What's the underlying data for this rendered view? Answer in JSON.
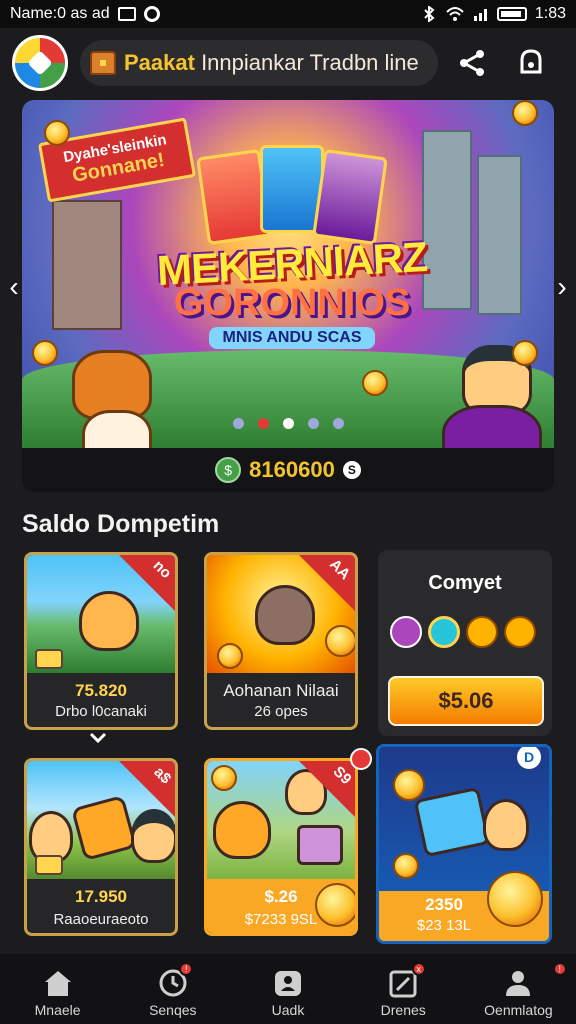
{
  "status_bar": {
    "left_text": "Name:0 as ad",
    "time": "1:83"
  },
  "header": {
    "title_accent": "Paakat",
    "title_rest": " Innpiankar Tradbn line"
  },
  "banner": {
    "ribbon_line1": "Dyahe'sleinkin",
    "ribbon_line2": "Gonnane!",
    "headline_line1": "MEKERNIARZ",
    "headline_line2": "GORONNIOS",
    "headline_line3": "MNIS ANDU SCAS",
    "balance": "8160600",
    "balance_coin_letter": "S",
    "dots": 5,
    "active_dot": 2
  },
  "section": {
    "title": "Saldo Dompetim"
  },
  "cards": [
    {
      "price": "75.820",
      "name": "Drbo l0canaki",
      "corner": "no"
    },
    {
      "price": "Aohanan Nilaai",
      "name": "26 opes",
      "corner": "AA"
    },
    {
      "price": "17.950",
      "name": "Raaoeuraeoto",
      "corner": "a$"
    },
    {
      "price": "$.26",
      "name": "$7233 9SL",
      "corner": "S9"
    },
    {
      "price": "2350",
      "name": "$23 13L",
      "corner": ""
    }
  ],
  "promo": {
    "title": "Comyet",
    "button_label": "$5.06"
  },
  "bottom_nav": [
    {
      "label": "Mnaele",
      "icon": "home-icon",
      "badge": false
    },
    {
      "label": "Senqes",
      "icon": "clock-icon",
      "badge": true
    },
    {
      "label": "Uadk",
      "icon": "profile-card-icon",
      "badge": false
    },
    {
      "label": "Drenes",
      "icon": "edit-icon",
      "badge": true
    },
    {
      "label": "Oenmlatog",
      "icon": "user-icon",
      "badge": true
    }
  ],
  "colors": {
    "accent_gold": "#f4c430",
    "badge_red": "#e53935",
    "card_border": "#c9a14a",
    "background": "#1c1c1e"
  }
}
